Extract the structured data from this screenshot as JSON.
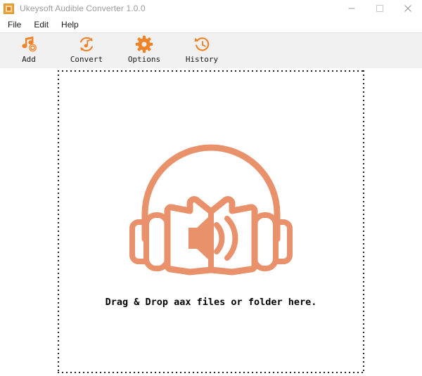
{
  "window": {
    "title": "Ukeysoft Audible Converter 1.0.0",
    "app_icon": "app-logo-icon",
    "controls": {
      "minimize": "minimize-icon",
      "maximize": "maximize-icon",
      "close": "close-icon"
    }
  },
  "menubar": {
    "items": [
      {
        "label": "File"
      },
      {
        "label": "Edit"
      },
      {
        "label": "Help"
      }
    ]
  },
  "toolbar": {
    "buttons": [
      {
        "label": "Add",
        "icon": "music-note-add-icon"
      },
      {
        "label": "Convert",
        "icon": "convert-refresh-note-icon"
      },
      {
        "label": "Options",
        "icon": "gear-icon"
      },
      {
        "label": "History",
        "icon": "clock-history-icon"
      }
    ]
  },
  "dropzone": {
    "illustration": "audiobook-headphones-icon",
    "message": "Drag & Drop aax files or folder here."
  },
  "colors": {
    "accent": "#F08228",
    "illustration": "#E8916A",
    "toolbar_bg": "#F0F0F0",
    "title_text": "#9B9B9B",
    "dash_border": "#222222"
  }
}
